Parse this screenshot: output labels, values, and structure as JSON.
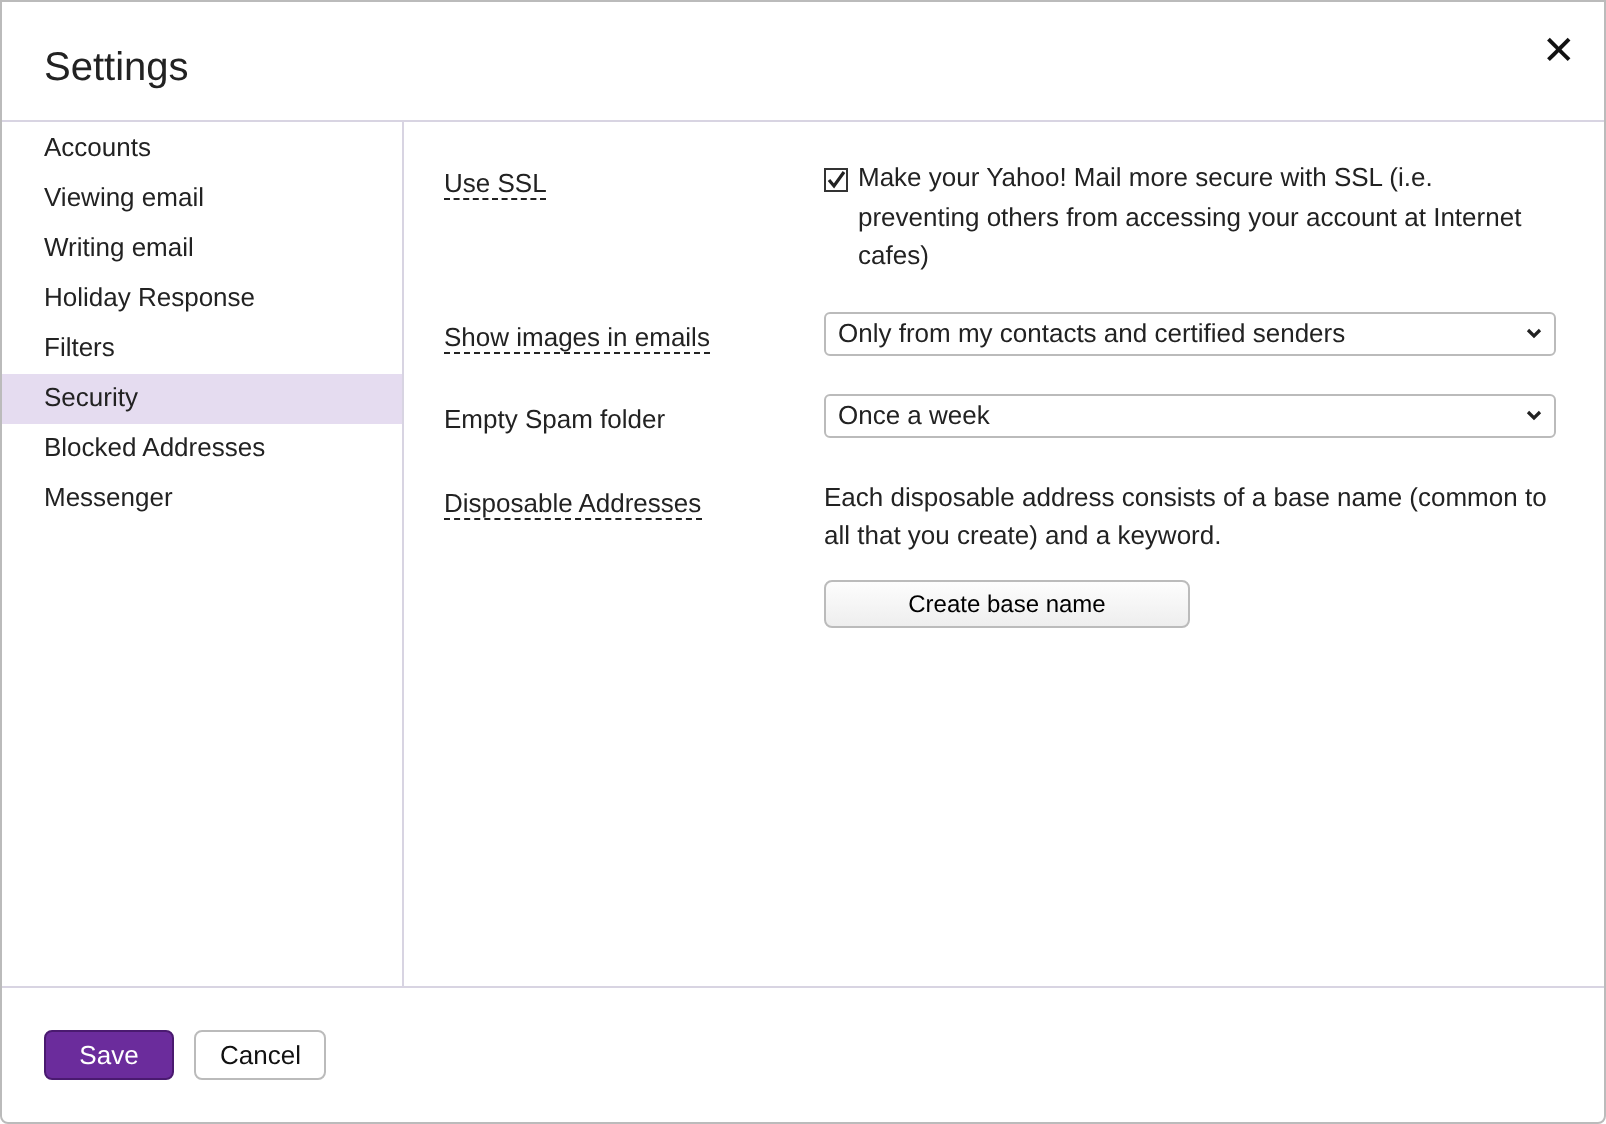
{
  "dialog": {
    "title": "Settings",
    "close": "✕"
  },
  "sidebar": {
    "items": [
      {
        "label": "Accounts",
        "selected": false
      },
      {
        "label": "Viewing email",
        "selected": false
      },
      {
        "label": "Writing email",
        "selected": false
      },
      {
        "label": "Holiday Response",
        "selected": false
      },
      {
        "label": "Filters",
        "selected": false
      },
      {
        "label": "Security",
        "selected": true
      },
      {
        "label": "Blocked Addresses",
        "selected": false
      },
      {
        "label": "Messenger",
        "selected": false
      }
    ]
  },
  "settings": [
    {
      "label": "Use SSL",
      "has_help": true,
      "kind": "checkbox",
      "checked": true,
      "text": "Make your Yahoo! Mail more secure with SSL (i.e. preventing others from accessing your account at Internet cafes)"
    },
    {
      "label": "Show images in emails",
      "has_help": true,
      "kind": "select",
      "value": "Only from my contacts and certified senders"
    },
    {
      "label": "Empty Spam folder",
      "has_help": false,
      "kind": "select",
      "value": "Once a week"
    },
    {
      "label": "Disposable Addresses",
      "has_help": true,
      "kind": "action",
      "text": "Each disposable address consists of a base name (common to all that you create) and a keyword.",
      "button": "Create base name"
    }
  ],
  "footer": {
    "buttons": [
      {
        "label": "Save",
        "kind": "primary"
      },
      {
        "label": "Cancel",
        "kind": "secondary"
      }
    ]
  }
}
